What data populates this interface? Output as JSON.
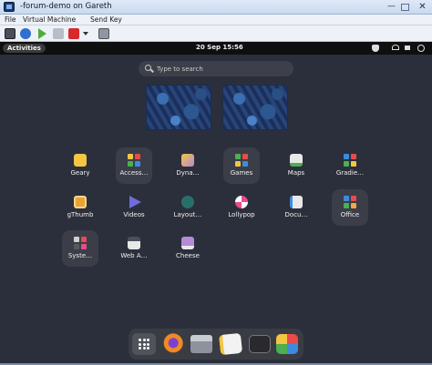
{
  "window": {
    "title": "-forum-demo on Gareth",
    "minimize_glyph": "—",
    "close_glyph": "✕"
  },
  "menu": [
    "File",
    "Virtual Machine",
    "Send Key"
  ],
  "topbar": {
    "activities": "Activities",
    "clock": "20 Sep  15:56"
  },
  "search": {
    "placeholder": "Type to search"
  },
  "apps": [
    {
      "label": "Geary",
      "icon": "geary-icon",
      "color": "#f4c542"
    },
    {
      "label": "Access…",
      "icon": "accessories-folder-icon",
      "color": "#3b3e48"
    },
    {
      "label": "Dyna…",
      "icon": "dynamic-wallpaper-icon",
      "color": "#b58ad6"
    },
    {
      "label": "Games",
      "icon": "games-folder-icon",
      "color": "#3b3e48"
    },
    {
      "label": "Maps",
      "icon": "maps-icon",
      "color": "#e8e8e8"
    },
    {
      "label": "Gradie…",
      "icon": "gradience-icon",
      "color": "#3b3e48"
    },
    {
      "label": "gThumb",
      "icon": "gthumb-icon",
      "color": "#e8a23a"
    },
    {
      "label": "Videos",
      "icon": "videos-icon",
      "color": "#6f6ce0"
    },
    {
      "label": "Layout…",
      "icon": "layout-icon",
      "color": "#2a6e6a"
    },
    {
      "label": "Lollypop",
      "icon": "lollypop-icon",
      "color": "#e94b8c"
    },
    {
      "label": "Docu…",
      "icon": "document-viewer-icon",
      "color": "#e8e8e8"
    },
    {
      "label": "Office",
      "icon": "office-folder-icon",
      "color": "#3b3e48"
    },
    {
      "label": "Syste…",
      "icon": "system-folder-icon",
      "color": "#3b3e48"
    },
    {
      "label": "Web A…",
      "icon": "web-apps-icon",
      "color": "#e8e8e8"
    },
    {
      "label": "Cheese",
      "icon": "cheese-icon",
      "color": "#b58ad6"
    }
  ],
  "dock": [
    "show-apps-icon",
    "firefox-icon",
    "files-icon",
    "text-editor-icon",
    "terminal-icon",
    "software-icon"
  ]
}
